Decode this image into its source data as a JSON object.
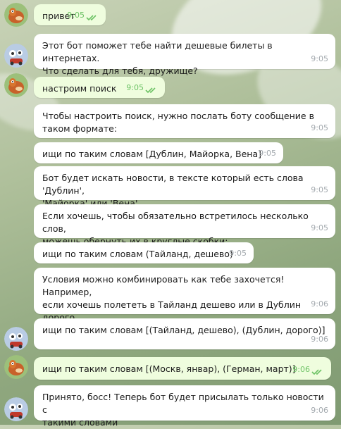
{
  "messages": [
    {
      "dir": "out",
      "text": "привет",
      "time": "9:05"
    },
    {
      "dir": "in",
      "text": "Этот бот поможет тебе найти дешевые билеты в интернетах.\nЧто сделать для тебя, дружище?",
      "time": "9:05"
    },
    {
      "dir": "out",
      "text": "настроим поиск",
      "time": "9:05"
    },
    {
      "dir": "in",
      "text": "Чтобы настроить поиск, нужно послать боту сообщение в\nтаком формате:",
      "time": "9:05"
    },
    {
      "dir": "in",
      "text": "ищи по таким словам [Дублин, Майорка, Вена]",
      "time": "9:05"
    },
    {
      "dir": "in",
      "text": "Бот будет искать новости, в тексте который есть слова 'Дублин',\n'Майорка' или 'Вена'",
      "time": "9:05"
    },
    {
      "dir": "in",
      "text": "Если хочешь, чтобы обязательно встретилось несколько слов,\nможешь обернуть их в круглые скобки:",
      "time": "9:05"
    },
    {
      "dir": "in",
      "text": "ищи по таким словам (Тайланд, дешево)",
      "time": "9:05"
    },
    {
      "dir": "in",
      "text": "Условия можно комбинировать как тебе захочется! Например,\nесли хочешь полететь в Тайланд дешево или в Дублин дорого,\nсделай так:",
      "time": "9:06"
    },
    {
      "dir": "in",
      "text": "ищи по таким словам [(Тайланд, дешево), (Дублин, дорого)]",
      "time": "9:06"
    },
    {
      "dir": "out",
      "text": "ищи по таким словам [(Москв, январ), (Герман, март)]",
      "time": "9:06"
    },
    {
      "dir": "in",
      "text": "Принято, босс! Теперь бот будет присылать только новости с\nтакими словами",
      "time": "9:06"
    }
  ],
  "colors": {
    "incoming_bubble": "#ffffff",
    "outgoing_bubble": "#effdde",
    "read_checks": "#6cc264",
    "time_text": "#a3a9ae"
  },
  "icons": {
    "user_avatar": "fox-avatar-icon",
    "bot_avatar": "bot-avatar-icon",
    "read_receipt": "double-check-icon"
  }
}
